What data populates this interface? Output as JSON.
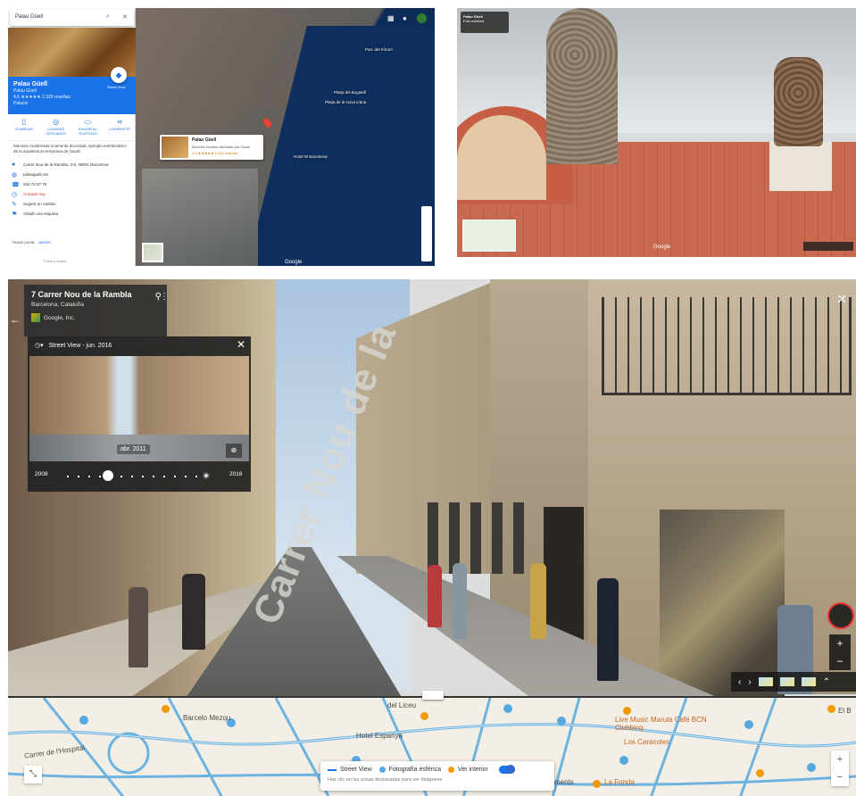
{
  "panel1": {
    "search": "Palau Güell",
    "place_title": "Palau Güell",
    "place_subtitle": "Palau Güell",
    "rating": "4,6 ★★★★★ 2.326 reseñas",
    "category": "Palacio",
    "street_view_label": "Street View",
    "actions": [
      "GUARDAR",
      "LUGARES CERCANOS",
      "ENVIAR AL TELÉFONO",
      "COMPARTIR"
    ],
    "description": "Mansión modernista ricamente decorada, ejemplo emblemático de la arquitectura temprana de Gaudí.",
    "info": [
      "Carrer Nou de la Rambla, 3-5, 08001 Barcelona",
      "palauguell.cat",
      "934 72 57 75",
      "Cerrado hoy",
      "Sugerir un cambio",
      "Añadir una etiqueta"
    ],
    "popular_times": "Horas punta",
    "popular_day": "Jueves",
    "footer": "Fotos y vídeos",
    "card_title": "Palau Güell",
    "card_sub": "Mansión familiar diseñada por Gaudí",
    "card_rating": "4,6 ★★★★★ 2.326 reseñas",
    "map_labels": [
      "Parc del Fòrum",
      "Platja del Bogatell",
      "Platja de la Nova Icària",
      "Hotel W Barcelona",
      "Google"
    ]
  },
  "panel2": {
    "label_title": "Palau Güell",
    "label_sub": "Foto esférica",
    "google": "Google"
  },
  "panel3": {
    "address": "7 Carrer Nou de la Rambla",
    "city": "Barcelona, Cataluña",
    "owner": "Google, Inc.",
    "history_title": "Street View - jun. 2016",
    "history_date": "abr. 2011",
    "year_start": "2008",
    "year_end": "2016",
    "road_text": "Carrer Nou de la",
    "legend_street": "Street View",
    "legend_sphere": "Fotografía esférica",
    "legend_interior": "Ver interior",
    "legend_hint": "Haz clic en las zonas destacadas para ver imágenes",
    "map_labels": [
      "Barcelo Mezqu",
      "Hotel Espanya",
      "del Liceu",
      "Live Music Marula Café BCN Clubbing",
      "Los Caracoles",
      "La Fonda",
      "El B",
      "Carrer de l'Hospital",
      "ments"
    ],
    "colors": {
      "street": "#1a73e8",
      "sphere": "#56a9e0",
      "interior": "#f29900"
    }
  }
}
